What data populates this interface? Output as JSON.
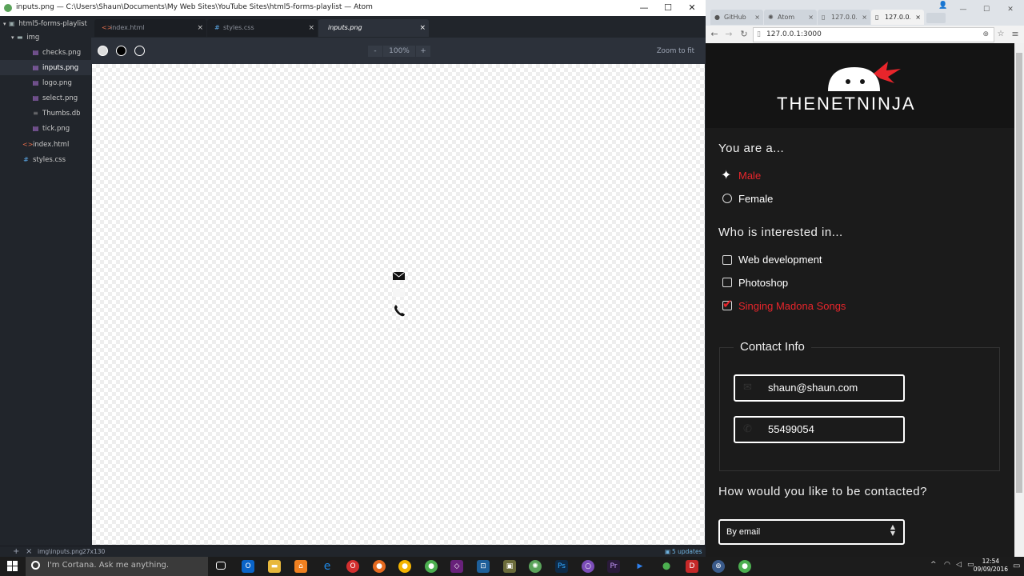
{
  "atom": {
    "window_title": "inputs.png — C:\\Users\\Shaun\\Documents\\My Web Sites\\YouTube Sites\\html5-forms-playlist — Atom",
    "window_controls": [
      "—",
      "☐",
      "✕"
    ],
    "tree": {
      "root": "html5-forms-playlist",
      "folder": "img",
      "files": [
        {
          "name": "checks.png",
          "type": "img"
        },
        {
          "name": "inputs.png",
          "type": "img",
          "selected": true
        },
        {
          "name": "logo.png",
          "type": "img"
        },
        {
          "name": "select.png",
          "type": "img"
        },
        {
          "name": "Thumbs.db",
          "type": "db"
        },
        {
          "name": "tick.png",
          "type": "img"
        }
      ],
      "root_files": [
        {
          "name": "index.html",
          "type": "html"
        },
        {
          "name": "styles.css",
          "type": "css"
        }
      ]
    },
    "tabs": [
      {
        "label": "index.html",
        "icon": "<>",
        "close": "×"
      },
      {
        "label": "styles.css",
        "icon": "#",
        "close": "×"
      },
      {
        "label": "inputs.png",
        "icon": "",
        "close": "×",
        "active": true
      }
    ],
    "image_toolbar": {
      "zoom_out": "-",
      "zoom_level": "100%",
      "zoom_in": "+",
      "zoom_to_fit": "Zoom to fit"
    },
    "statusbar": {
      "add": "+",
      "close": "×",
      "path": "img\\inputs.png",
      "dimensions": "27x130",
      "updates": "5 updates"
    }
  },
  "chrome": {
    "tabs": [
      {
        "label": "GitHub",
        "close": "×"
      },
      {
        "label": "Atom",
        "close": "×"
      },
      {
        "label": "127.0.0.1",
        "close": "×"
      },
      {
        "label": "127.0.0.1",
        "close": "×",
        "active": true
      }
    ],
    "url": "127.0.0.1:3000",
    "window_controls": [
      "—",
      "☐",
      "✕"
    ]
  },
  "page": {
    "logo_text": "THENETNINJA",
    "gender": {
      "heading": "You are a...",
      "options": [
        {
          "label": "Male",
          "checked": true
        },
        {
          "label": "Female",
          "checked": false
        }
      ]
    },
    "interests": {
      "heading": "Who is interested in...",
      "options": [
        {
          "label": "Web development",
          "checked": false
        },
        {
          "label": "Photoshop",
          "checked": false
        },
        {
          "label": "Singing Madona Songs",
          "checked": true
        }
      ]
    },
    "contact": {
      "legend": "Contact Info",
      "email": "shaun@shaun.com",
      "phone": "55499054"
    },
    "contact_method": {
      "heading": "How would you like to be contacted?",
      "selected": "By email"
    }
  },
  "taskbar": {
    "cortana_text": "I'm Cortana. Ask me anything.",
    "time": "12:54",
    "date": "09/09/2016"
  },
  "colors": {
    "accent_red": "#e8252b",
    "page_bg": "#1b1b1b",
    "atom_bg": "#21252b"
  }
}
